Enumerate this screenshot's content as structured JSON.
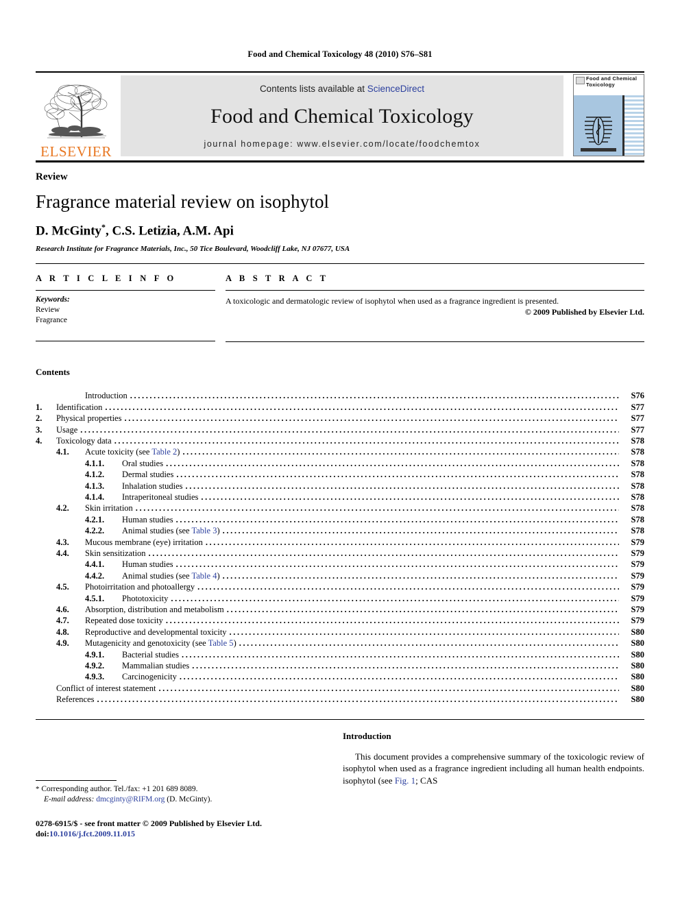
{
  "running_head": "Food and Chemical Toxicology 48 (2010) S76–S81",
  "banner": {
    "publisher_name": "ELSEVIER",
    "contents_prefix": "Contents lists available at ",
    "sciencedirect": "ScienceDirect",
    "journal_name": "Food and Chemical Toxicology",
    "homepage": "journal homepage: www.elsevier.com/locate/foodchemtox",
    "cover_title": "Food and Chemical Toxicology"
  },
  "article": {
    "doctype": "Review",
    "title": "Fragrance material review on isophytol",
    "authors": "D. McGinty",
    "authors_rest": ", C.S. Letizia, A.M. Api",
    "corresponding_marker": "*",
    "affiliation": "Research Institute for Fragrance Materials, Inc., 50 Tice Boulevard, Woodcliff Lake, NJ 07677, USA"
  },
  "info": {
    "heading": "A R T I C L E    I N F O",
    "keywords_label": "Keywords:",
    "keywords": [
      "Review",
      "Fragrance"
    ]
  },
  "abstract": {
    "heading": "A B S T R A C T",
    "text": "A toxicologic and dermatologic review of isophytol when used as a fragrance ingredient is presented.",
    "copyright": "© 2009 Published by Elsevier Ltd."
  },
  "contents": {
    "heading": "Contents",
    "entries": [
      {
        "num": "",
        "label": "Introduction",
        "page": "S76",
        "level": 0,
        "style": "no-num"
      },
      {
        "num": "1.",
        "label": "Identification",
        "page": "S77",
        "level": 0,
        "style": ""
      },
      {
        "num": "2.",
        "label": "Physical properties",
        "page": "S77",
        "level": 0,
        "style": ""
      },
      {
        "num": "3.",
        "label": "Usage",
        "page": "S77",
        "level": 0,
        "style": ""
      },
      {
        "num": "4.",
        "label": "Toxicology data",
        "page": "S78",
        "level": 0,
        "style": ""
      },
      {
        "num": "4.1.",
        "label": "Acute toxicity (see ",
        "link": "Table 2",
        "label_end": ")",
        "page": "S78",
        "level": 1,
        "style": ""
      },
      {
        "num": "4.1.1.",
        "label": "Oral studies",
        "page": "S78",
        "level": 2,
        "style": ""
      },
      {
        "num": "4.1.2.",
        "label": "Dermal studies",
        "page": "S78",
        "level": 2,
        "style": ""
      },
      {
        "num": "4.1.3.",
        "label": "Inhalation studies",
        "page": "S78",
        "level": 2,
        "style": ""
      },
      {
        "num": "4.1.4.",
        "label": "Intraperitoneal studies",
        "page": "S78",
        "level": 2,
        "style": ""
      },
      {
        "num": "4.2.",
        "label": "Skin irritation",
        "page": "S78",
        "level": 1,
        "style": ""
      },
      {
        "num": "4.2.1.",
        "label": "Human studies",
        "page": "S78",
        "level": 2,
        "style": ""
      },
      {
        "num": "4.2.2.",
        "label": "Animal studies (see ",
        "link": "Table 3",
        "label_end": ")",
        "page": "S78",
        "level": 2,
        "style": ""
      },
      {
        "num": "4.3.",
        "label": "Mucous membrane (eye) irritation",
        "page": "S79",
        "level": 1,
        "style": ""
      },
      {
        "num": "4.4.",
        "label": "Skin sensitization",
        "page": "S79",
        "level": 1,
        "style": ""
      },
      {
        "num": "4.4.1.",
        "label": "Human studies",
        "page": "S79",
        "level": 2,
        "style": ""
      },
      {
        "num": "4.4.2.",
        "label": "Animal studies (see ",
        "link": "Table 4",
        "label_end": ")",
        "page": "S79",
        "level": 2,
        "style": ""
      },
      {
        "num": "4.5.",
        "label": "Photoirritation and photoallergy",
        "page": "S79",
        "level": 1,
        "style": ""
      },
      {
        "num": "4.5.1.",
        "label": "Phototoxicity",
        "page": "S79",
        "level": 2,
        "style": ""
      },
      {
        "num": "4.6.",
        "label": "Absorption, distribution and metabolism",
        "page": "S79",
        "level": 1,
        "style": ""
      },
      {
        "num": "4.7.",
        "label": "Repeated dose toxicity",
        "page": "S79",
        "level": 1,
        "style": ""
      },
      {
        "num": "4.8.",
        "label": "Reproductive and developmental toxicity",
        "page": "S80",
        "level": 1,
        "style": ""
      },
      {
        "num": "4.9.",
        "label": "Mutagenicity and genotoxicity (see ",
        "link": "Table 5",
        "label_end": ")",
        "page": "S80",
        "level": 1,
        "style": ""
      },
      {
        "num": "4.9.1.",
        "label": "Bacterial studies",
        "page": "S80",
        "level": 2,
        "style": ""
      },
      {
        "num": "4.9.2.",
        "label": "Mammalian studies",
        "page": "S80",
        "level": 2,
        "style": ""
      },
      {
        "num": "4.9.3.",
        "label": "Carcinogenicity",
        "page": "S80",
        "level": 2,
        "style": ""
      },
      {
        "num": "",
        "label": "Conflict of interest statement",
        "page": "S80",
        "level": 0,
        "style": "plain"
      },
      {
        "num": "",
        "label": "References",
        "page": "S80",
        "level": 0,
        "style": "plain"
      }
    ]
  },
  "footnote": {
    "star": "*",
    "corresponding": "Corresponding author. Tel./fax: +1 201 689 8089.",
    "email_label": "E-mail address:",
    "email": "dmcginty@RIFM.org",
    "email_owner": "(D. McGinty)."
  },
  "imprint": {
    "issn_line": "0278-6915/$ - see front matter © 2009 Published by Elsevier Ltd.",
    "doi_label": "doi:",
    "doi": "10.1016/j.fct.2009.11.015"
  },
  "introduction": {
    "heading": "Introduction",
    "body_start": "This document provides a comprehensive summary of the toxicologic review of isophytol when used as a fragrance ingredient including all human health endpoints. isophytol (see ",
    "figure_link": "Fig. 1",
    "body_end": "; CAS"
  },
  "colors": {
    "link": "#2b3f9e",
    "elsevier_orange": "#E87722",
    "banner_gray": "#e3e3e3",
    "cover_blue": "#a8c6e0"
  }
}
